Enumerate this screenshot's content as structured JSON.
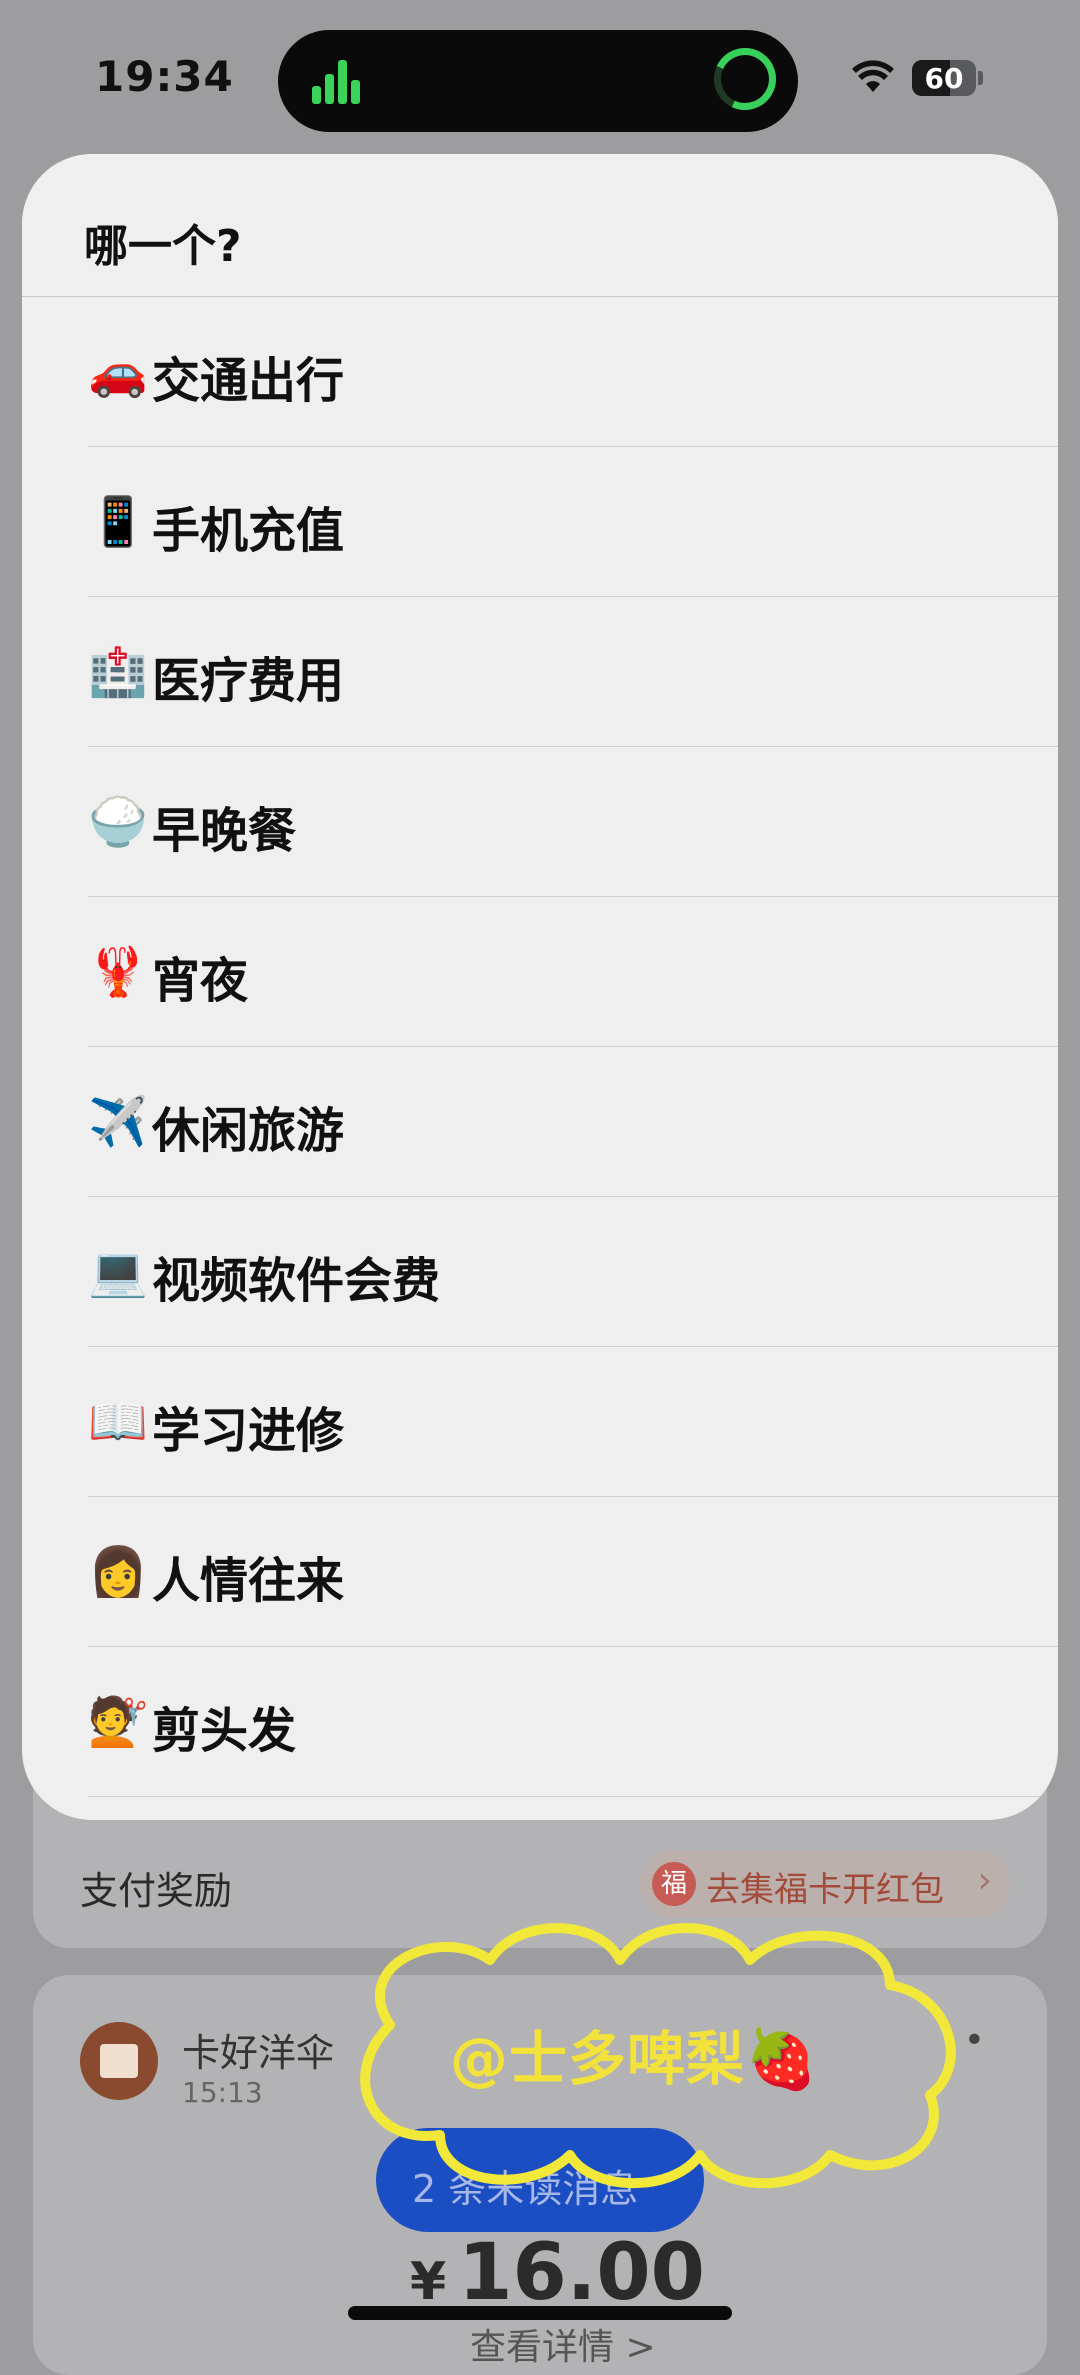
{
  "status_bar": {
    "time": "19:34",
    "battery": "60"
  },
  "sheet": {
    "title": "哪一个?",
    "items": [
      {
        "emoji": "🚗",
        "label": "交通出行"
      },
      {
        "emoji": "📱",
        "label": "手机充值"
      },
      {
        "emoji": "🏥",
        "label": "医疗费用"
      },
      {
        "emoji": "🍚",
        "label": "早晚餐"
      },
      {
        "emoji": "🦞",
        "label": "宵夜"
      },
      {
        "emoji": "✈️",
        "label": "休闲旅游"
      },
      {
        "emoji": "💻",
        "label": "视频软件会费"
      },
      {
        "emoji": "📖",
        "label": "学习进修"
      },
      {
        "emoji": "👩",
        "label": "人情往来"
      },
      {
        "emoji": "💇",
        "label": "剪头发"
      }
    ]
  },
  "background": {
    "reward_label": "支付奖励",
    "reward_icon": "福",
    "reward_link": "去集福卡开红包",
    "store_name": "卡好洋伞",
    "store_time": "15:13",
    "unread": "2 条未读消息",
    "currency": "¥",
    "amount": "16.00",
    "detail": "查看详情 >"
  },
  "watermark": "@士多啤梨🍓",
  "colors": {
    "accent_green": "#37d05a",
    "pill_blue": "#1a4ec2",
    "watermark_yellow": "#f2e23a"
  }
}
